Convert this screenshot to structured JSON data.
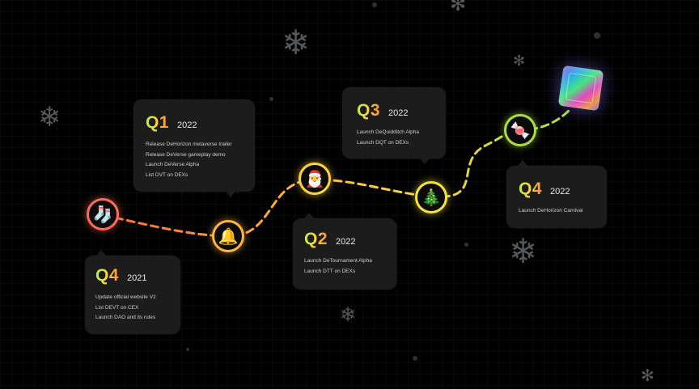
{
  "milestones": [
    {
      "quarter": "Q4",
      "year": "2021",
      "items": [
        "Update official website V2",
        "List DEVT on CEX",
        "Launch DAO and its rules"
      ],
      "node_icon": "christmas-stocking-icon",
      "node_color": "#ff6a5a"
    },
    {
      "quarter": "Q1",
      "year": "2022",
      "items": [
        "Release DeHorizon metaverse trailer",
        "Release DeVerse gameplay demo",
        "Launch DeVerse Alpha",
        "List DVT on DEXs"
      ],
      "node_icon": "christmas-bells-icon",
      "node_color": "#ffb43a"
    },
    {
      "quarter": "Q2",
      "year": "2022",
      "items": [
        "Launch DeTournament Alpha",
        "Launch DTT on DEXs"
      ],
      "node_icon": "santa-hat-icon",
      "node_color": "#ffd23a"
    },
    {
      "quarter": "Q3",
      "year": "2022",
      "items": [
        "Launch DeQuidditch Alpha",
        "Launch DQT on DEXs"
      ],
      "node_icon": "christmas-tree-icon",
      "node_color": "#f5e23a"
    },
    {
      "quarter": "Q4",
      "year": "2022",
      "items": [
        "Launch DeHorizon Carnival"
      ],
      "node_icon": "candy-cane-icon",
      "node_color": "#a8e03a"
    }
  ],
  "colors": {
    "card_bg": "#1c1c1c",
    "path_start": "#ff7a3a",
    "path_mid": "#ffd23a",
    "path_end": "#a8e03a"
  },
  "decor": {
    "gift_icon": "holographic-gift-cube-icon",
    "snowflake_icon": "snowflake-icon"
  }
}
